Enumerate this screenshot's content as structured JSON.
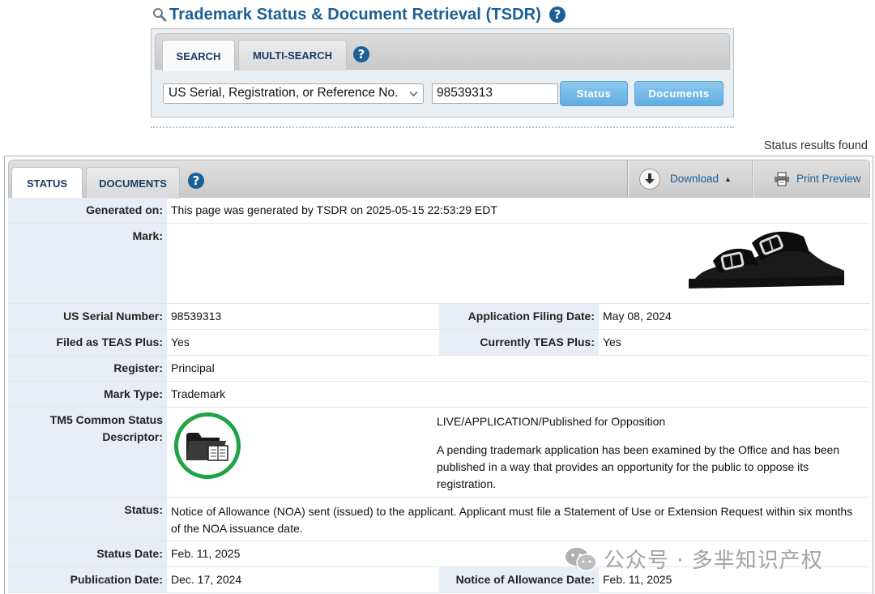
{
  "header": {
    "title": "Trademark Status & Document Retrieval (TSDR)",
    "search_icon": "magnifier-icon",
    "help_icon": "help-icon"
  },
  "search": {
    "tabs": [
      {
        "label": "SEARCH",
        "active": true
      },
      {
        "label": "MULTI-SEARCH",
        "active": false
      }
    ],
    "select_value": "US Serial, Registration, or Reference No.",
    "input_value": "98539313",
    "status_button": "Status",
    "documents_button": "Documents"
  },
  "results": {
    "found_text": "Status results found",
    "tabs": [
      {
        "label": "STATUS",
        "active": true
      },
      {
        "label": "DOCUMENTS",
        "active": false
      }
    ],
    "download_label": "Download",
    "print_label": "Print Preview"
  },
  "record": {
    "generated_on": {
      "label": "Generated on:",
      "value": "This page was generated by TSDR on 2025-05-15 22:53:29 EDT"
    },
    "mark": {
      "label": "Mark:"
    },
    "serial_number": {
      "label": "US Serial Number:",
      "value": "98539313"
    },
    "filing_date": {
      "label": "Application Filing Date:",
      "value": "May 08, 2024"
    },
    "teas_plus": {
      "label": "Filed as TEAS Plus:",
      "value": "Yes"
    },
    "current_teas_plus": {
      "label": "Currently TEAS Plus:",
      "value": "Yes"
    },
    "register": {
      "label": "Register:",
      "value": "Principal"
    },
    "mark_type": {
      "label": "Mark Type:",
      "value": "Trademark"
    },
    "tm5": {
      "label_line1": "TM5 Common Status",
      "label_line2": "Descriptor:",
      "status_line": "LIVE/APPLICATION/Published for Opposition",
      "description": "A pending trademark application has been examined by the Office and has been published in a way that provides an opportunity for the public to oppose its registration."
    },
    "status": {
      "label": "Status:",
      "value": "Notice of Allowance (NOA) sent (issued) to the applicant. Applicant must file a Statement of Use or Extension Request within six months of the NOA issuance date."
    },
    "status_date": {
      "label": "Status Date:",
      "value": "Feb. 11, 2025"
    },
    "publication_date": {
      "label": "Publication Date:",
      "value": "Dec. 17, 2024"
    },
    "noa_date": {
      "label": "Notice of Allowance Date:",
      "value": "Feb. 11, 2025"
    }
  },
  "watermark": {
    "text": "公众号 · 多芈知识产权"
  },
  "colors": {
    "brand_blue": "#1b5f96",
    "label_bg": "#e8edf5",
    "button_blue": "#62aee0",
    "tm5_green": "#1fa344"
  }
}
